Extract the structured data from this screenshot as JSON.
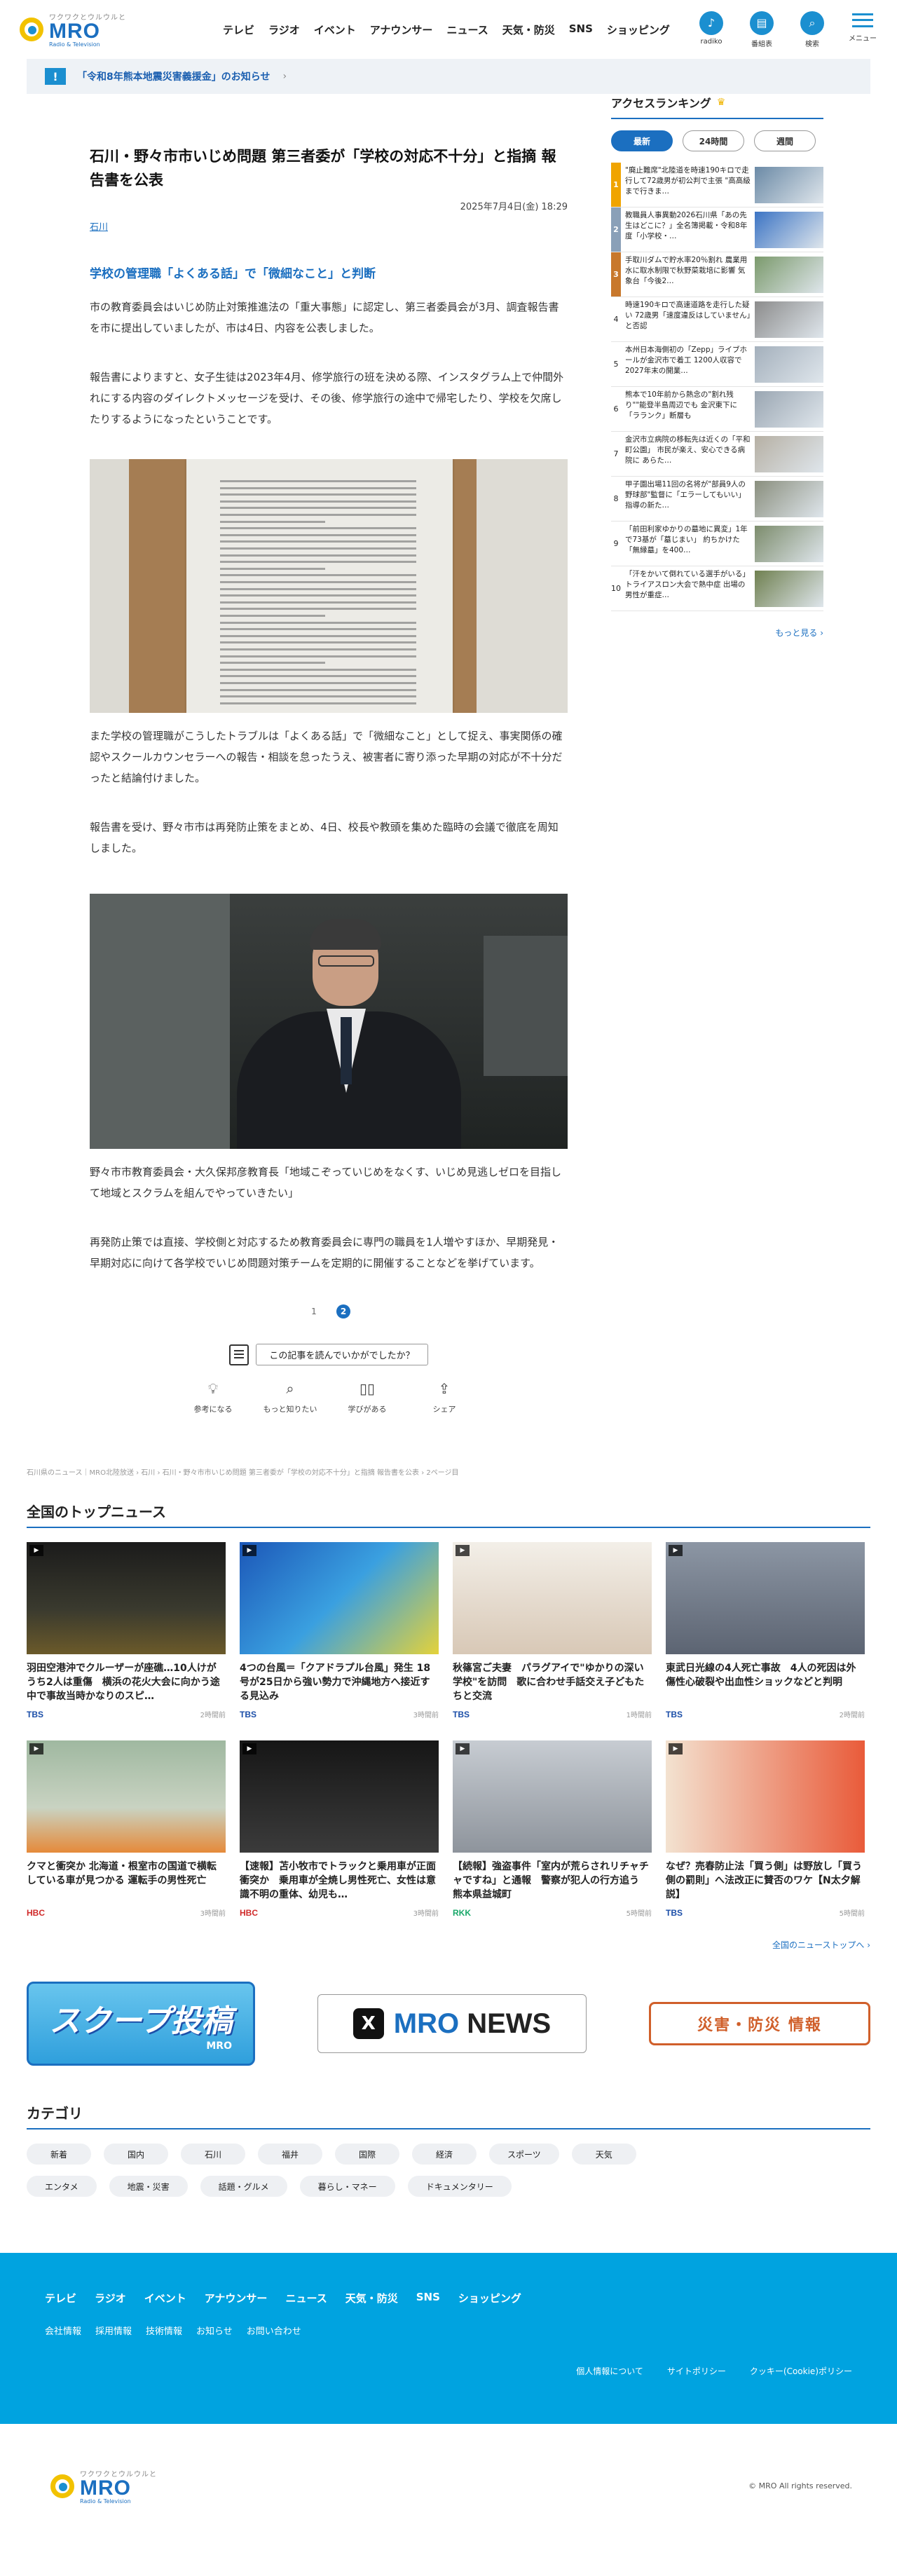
{
  "header": {
    "logo_tagline": "ワクワクとウルウルと",
    "logo_name": "MRO",
    "logo_sub": "Radio & Television",
    "nav": [
      "テレビ",
      "ラジオ",
      "イベント",
      "アナウンサー",
      "ニュース",
      "天気・防災",
      "SNS",
      "ショッピング"
    ],
    "icons": [
      {
        "label": "radiko",
        "icon": "radio-icon"
      },
      {
        "label": "番組表",
        "icon": "program-guide-icon"
      },
      {
        "label": "検索",
        "icon": "search-icon"
      }
    ],
    "menu_label": "メニュー"
  },
  "notice": {
    "mark": "!",
    "text": "「令和8年熊本地震災害義援金」のお知らせ"
  },
  "article": {
    "title": "石川・野々市市いじめ問題 第三者委が「学校の対応不十分」と指摘 報告書を公表",
    "date": "2025年7月4日(金) 18:29",
    "category": "石川",
    "subheading": "学校の管理職「よくある話」で「微細なこと」と判断",
    "paragraphs": [
      "市の教育委員会はいじめ防止対策推進法の「重大事態」に認定し、第三者委員会が3月、調査報告書を市に提出していましたが、市は4日、内容を公表しました。",
      "報告書によりますと、女子生徒は2023年4月、修学旅行の班を決める際、インスタグラム上で仲間外れにする内容のダイレクトメッセージを受け、その後、修学旅行の途中で帰宅したり、学校を欠席したりするようになったということです。",
      "また学校の管理職がこうしたトラブルは「よくある話」で「微細なこと」として捉え、事実関係の確認やスクールカウンセラーへの報告・相談を怠ったうえ、被害者に寄り添った早期の対応が不十分だったと結論付けました。",
      "報告書を受け、野々市市は再発防止策をまとめ、4日、校長や教頭を集めた臨時の会議で徹底を周知しました。",
      "野々市市教育委員会・大久保邦彦教育長「地域こぞっていじめをなくす、いじめ見逃しゼロを目指して地域とスクラムを組んでやっていきたい」",
      "再発防止策では直接、学校側と対応するため教育委員会に専門の職員を1人増やすほか、早期発見・早期対応に向けて各学校でいじめ問題対策チームを定期的に開催することなどを挙げています。"
    ],
    "pages": [
      "1",
      "2"
    ],
    "current_page": "2",
    "survey_question": "この記事を読んでいかがでしたか？",
    "reactions": [
      {
        "label": "参考になる",
        "icon": "lightbulb-icon"
      },
      {
        "label": "もっと知りたい",
        "icon": "magnifier-icon"
      },
      {
        "label": "学びがある",
        "icon": "book-icon"
      },
      {
        "label": "シェア",
        "icon": "share-icon"
      }
    ]
  },
  "ranking": {
    "title": "アクセスランキング",
    "tabs": [
      "最新",
      "24時間",
      "週間"
    ],
    "active_tab": "最新",
    "items": [
      {
        "rank": "1",
        "text": "\"廃止難席\"北陸道を時速190キロで走行して72歳男が初公判で主張 \"高高級まで行きま…",
        "color": "#f0a400"
      },
      {
        "rank": "2",
        "text": "教職員人事異動2026石川県「あの先生はどこに？」全名簿掲載・令和8年度「小学校・…",
        "color": "#8aa0b8"
      },
      {
        "rank": "3",
        "text": "手取川ダムで貯水率20％割れ 農業用水に取水制限で秋野菜栽培に影響 気象台「今後2…",
        "color": "#c8782c"
      },
      {
        "rank": "4",
        "text": "時速190キロで高速道路を走行した疑い 72歳男「速度違反はしていません」と否認",
        "color": ""
      },
      {
        "rank": "5",
        "text": "本州日本海側初の「Zepp」ライブホールが金沢市で着工 1200人収容で2027年末の開業…",
        "color": ""
      },
      {
        "rank": "6",
        "text": "熊本で10年前から熱念の\"割れ残り\"\"能登半島周辺でも 金沢東下に「ラランク」断層も",
        "color": ""
      },
      {
        "rank": "7",
        "text": "金沢市立病院の移転先は近くの「平和町公園」 市民が楽え、安心できる病院に あらた…",
        "color": ""
      },
      {
        "rank": "8",
        "text": "甲子園出場11回の名将が\"部員9人の野球部\"監督に「エラーしてもいい」指導の新た…",
        "color": ""
      },
      {
        "rank": "9",
        "text": "「前田利家ゆかりの墓地に異変」1年で73基が「墓じまい」 約ちかけた「無縁墓」を400…",
        "color": ""
      },
      {
        "rank": "10",
        "text": "「汗をかいて倒れている選手がいる」トライアスロン大会で熱中症 出場の男性が重症…",
        "color": ""
      }
    ],
    "more": "もっと見る"
  },
  "breadcrumb": "石川県のニュース｜MRO北陸放送 › 石川 › 石川・野々市市いじめ問題 第三者委が「学校の対応不十分」と指摘 報告書を公表 › 2ページ目",
  "top_news": {
    "title": "全国のトップニュース",
    "items": [
      {
        "title": "羽田空港沖でクルーザーが座礁…10人けがうち2人は重傷　横浜の花火大会に向かう途中で事故当時かなりのスピ…",
        "source": "TBS",
        "time": "2時間前",
        "src_class": "tbs"
      },
      {
        "title": "4つの台風＝「クアドラプル台風」発生 18号が25日から強い勢力で沖縄地方へ接近する見込み",
        "source": "TBS",
        "time": "3時間前",
        "src_class": "tbs"
      },
      {
        "title": "秋篠宮ご夫妻　パラグアイで\"ゆかりの深い学校\"を訪問　歌に合わせ手話交え子どもたちと交流",
        "source": "TBS",
        "time": "1時間前",
        "src_class": "tbs"
      },
      {
        "title": "東武日光線の4人死亡事故　4人の死因は外傷性心破裂や出血性ショックなどと判明",
        "source": "TBS",
        "time": "2時間前",
        "src_class": "tbs"
      },
      {
        "title": "クマと衝突か 北海道・根室市の国道で横転している車が見つかる 運転手の男性死亡",
        "source": "HBC",
        "time": "3時間前",
        "src_class": "hbc"
      },
      {
        "title": "【速報】苫小牧市でトラックと乗用車が正面衝突か　乗用車が全焼し男性死亡、女性は意識不明の重体、幼児も…",
        "source": "HBC",
        "time": "3時間前",
        "src_class": "hbc"
      },
      {
        "title": "【続報】強盗事件「室内が荒らされリチャチャですね」と通報　警察が犯人の行方追う　熊本県益城町",
        "source": "RKK",
        "time": "5時間前",
        "src_class": "rkk"
      },
      {
        "title": "なぜ？売春防止法「買う側」は野放し「買う側の罰則」へ法改正に賛否のワケ【N太夕解説】",
        "source": "TBS",
        "time": "5時間前",
        "src_class": "tbs"
      }
    ],
    "more": "全国のニューストップへ"
  },
  "banners": {
    "scoop_title": "スクープ投稿",
    "scoop_sub": "MRO",
    "x_letter": "X",
    "news_brand": "MRO",
    "news_word": "NEWS",
    "disaster": "災害・防災 情報"
  },
  "categories": {
    "title": "カテゴリ",
    "items": [
      "新着",
      "国内",
      "石川",
      "福井",
      "国際",
      "経済",
      "スポーツ",
      "天気",
      "エンタメ",
      "地震・災害",
      "話題・グルメ",
      "暮らし・マネー",
      "ドキュメンタリー"
    ]
  },
  "footer": {
    "nav": [
      "テレビ",
      "ラジオ",
      "イベント",
      "アナウンサー",
      "ニュース",
      "天気・防災",
      "SNS",
      "ショッピング"
    ],
    "nav2": [
      "会社情報",
      "採用情報",
      "技術情報",
      "お知らせ",
      "お問い合わせ"
    ],
    "nav3": [
      "個人情報について",
      "サイトポリシー",
      "クッキー(Cookie)ポリシー"
    ],
    "copyright": "© MRO All rights reserved."
  },
  "colors": {
    "accent": "#1b6fc0",
    "footer": "#00a3e0",
    "brand_yellow": "#f2c200"
  }
}
